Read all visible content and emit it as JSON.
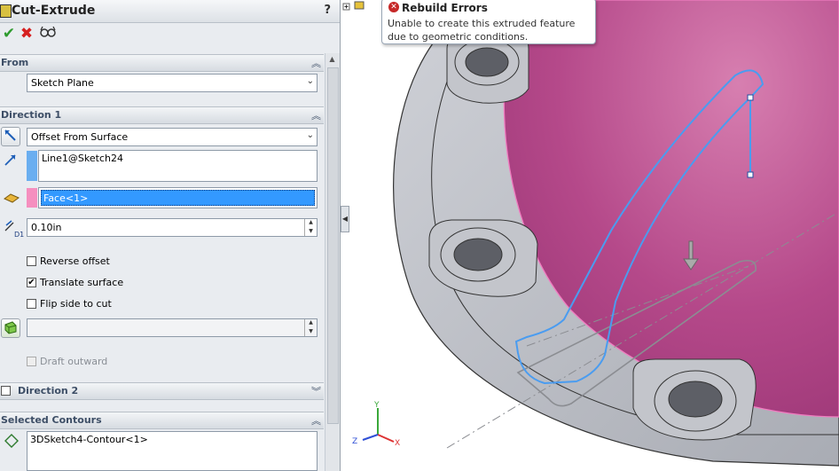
{
  "window": {
    "title": "Cut-Extrude",
    "help": "?"
  },
  "actions": {
    "ok": "✔",
    "cancel": "✖",
    "preview": "👓"
  },
  "from": {
    "header": "From",
    "selected": "Sketch Plane"
  },
  "direction1": {
    "header": "Direction 1",
    "end_condition": "Offset From Surface",
    "direction_ref": "Line1@Sketch24",
    "face_ref": "Face<1>",
    "offset_value": "0.10in",
    "reverse_offset": {
      "label": "Reverse offset",
      "checked": false
    },
    "translate_surface": {
      "label": "Translate surface",
      "checked": true
    },
    "flip_side": {
      "label": "Flip side to cut",
      "checked": false
    },
    "draft_outward": {
      "label": "Draft outward",
      "checked": false,
      "enabled": false
    },
    "d1_label": "D1"
  },
  "direction2": {
    "header": "Direction 2"
  },
  "selected_contours": {
    "header": "Selected Contours",
    "items": [
      "3DSketch4-Contour<1>"
    ]
  },
  "tooltip": {
    "title": "Rebuild Errors",
    "line1": "Unable to create this extruded feature",
    "line2": "due to geometric conditions."
  },
  "triad": {
    "x": "X",
    "y": "Y",
    "z": "Z"
  },
  "colors": {
    "accent_blue": "#3a8ee6",
    "face_pink": "#e97fb8",
    "face_fill": "#b04a86",
    "part_gray": "#b9bcc4"
  }
}
